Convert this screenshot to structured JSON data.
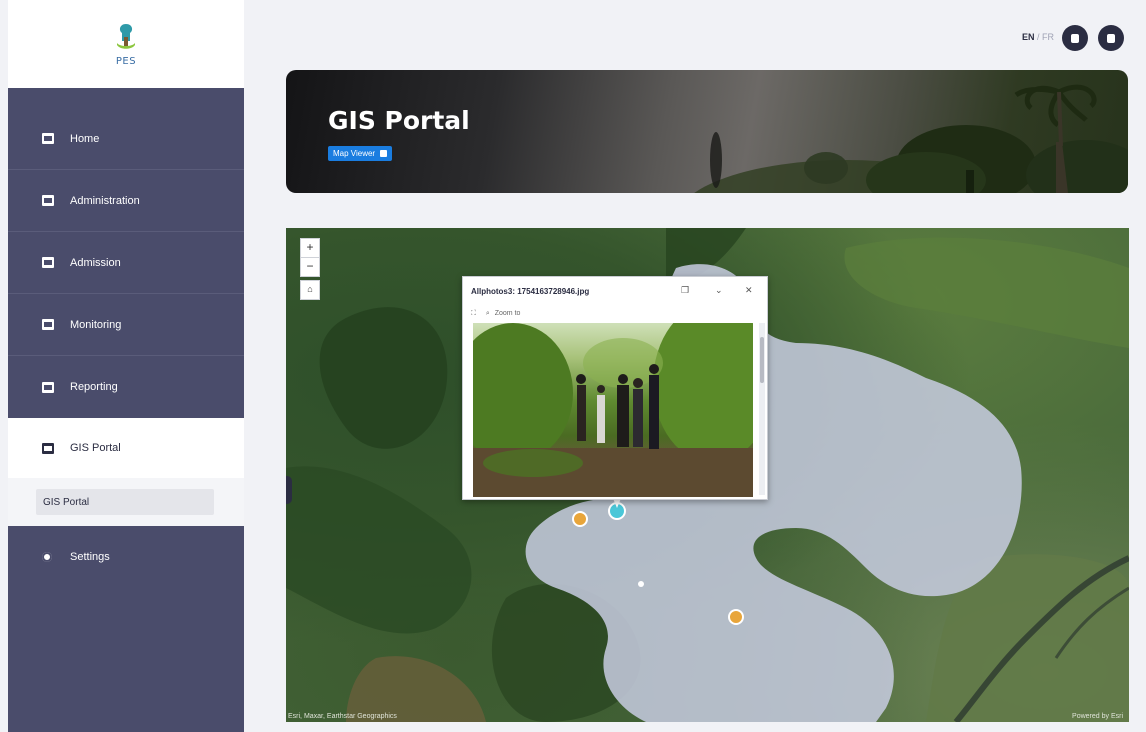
{
  "app": {
    "logo_text": "PES",
    "language": {
      "active": "EN",
      "separator": "/",
      "inactive": "FR"
    }
  },
  "sidebar": {
    "items": [
      {
        "label": "Home",
        "icon": "home-icon"
      },
      {
        "label": "Administration",
        "icon": "administration-icon"
      },
      {
        "label": "Admission",
        "icon": "admission-icon"
      },
      {
        "label": "Monitoring",
        "icon": "monitoring-icon"
      },
      {
        "label": "Reporting",
        "icon": "reporting-icon"
      },
      {
        "label": "GIS Portal",
        "icon": "map-icon",
        "active": true
      },
      {
        "label": "Settings",
        "icon": "gear-icon"
      }
    ],
    "submenu": {
      "label": "GIS Portal"
    }
  },
  "banner": {
    "title": "GIS Portal",
    "badge": "Map Viewer"
  },
  "map": {
    "zoom_in": "+",
    "zoom_out": "−",
    "home_icon": "home-icon",
    "attribution_left": "Esri, Maxar, Earthstar Geographics",
    "attribution_right": "Powered by Esri",
    "popup": {
      "title": "Allphotos3: 1754163728946.jpg",
      "dock_icon": "dock-icon",
      "minimize_icon": "minimize-icon",
      "close_icon": "close-icon",
      "tool_icon": "zoom-to-icon",
      "tool_label": "Zoom to"
    }
  },
  "colors": {
    "sidebar_bg": "#4a4c6b",
    "accent": "#1a7de0",
    "polygon": "#c8cde2"
  }
}
